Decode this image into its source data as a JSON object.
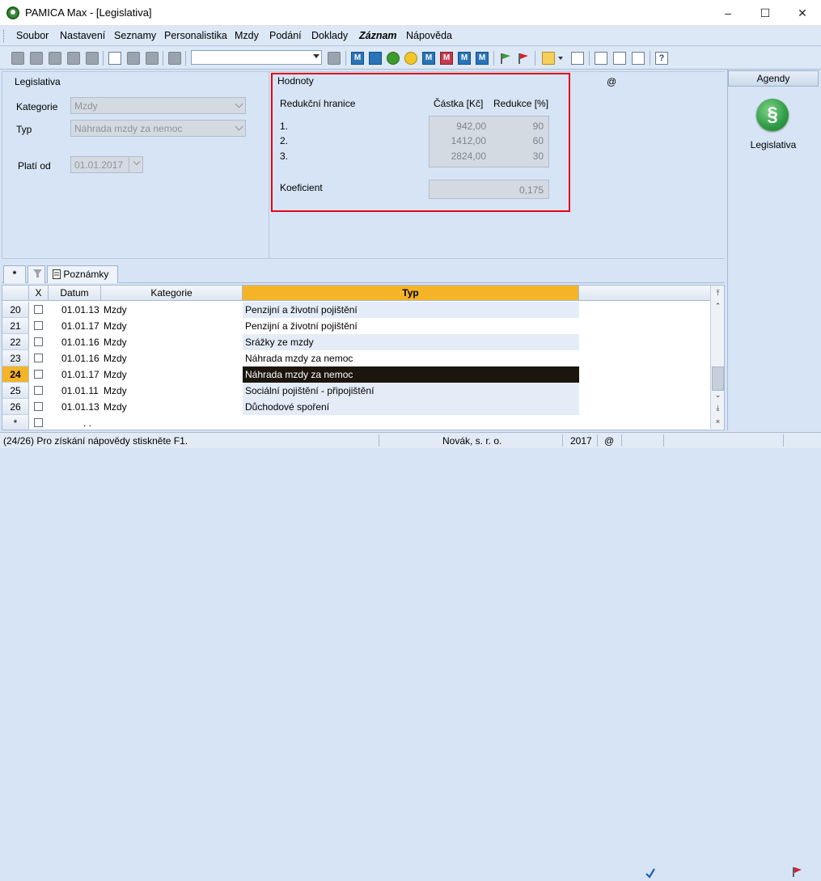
{
  "window": {
    "title": "PAMICA Max - [Legislativa]",
    "minimize": "–",
    "maximize": "☐",
    "close": "✕"
  },
  "menu": [
    "Soubor",
    "Nastavení",
    "Seznamy",
    "Personalistika",
    "Mzdy",
    "Podání",
    "Doklady",
    "Záznam",
    "Nápověda"
  ],
  "toolbar": {
    "combo_value": "",
    "letter_m": "M"
  },
  "form": {
    "section_title": "Legislativa",
    "kategorie_label": "Kategorie",
    "kategorie_value": "Mzdy",
    "typ_label": "Typ",
    "typ_value": "Náhrada mzdy za nemoc",
    "plati_od_label": "Platí od",
    "plati_od_value": "01.01.2017",
    "at_sign": "@"
  },
  "hodnoty": {
    "title": "Hodnoty",
    "col_hranice": "Redukční hranice",
    "col_castka": "Částka [Kč]",
    "col_redukce": "Redukce [%]",
    "rows": [
      {
        "label": "1.",
        "castka": "942,00",
        "redukce": "90"
      },
      {
        "label": "2.",
        "castka": "1412,00",
        "redukce": "60"
      },
      {
        "label": "3.",
        "castka": "2824,00",
        "redukce": "30"
      }
    ],
    "koeficient_label": "Koeficient",
    "koeficient_value": "0,175"
  },
  "agenda": {
    "header": "Agendy",
    "icon_glyph": "§",
    "item_label": "Legislativa"
  },
  "tabs": {
    "star": "*",
    "notes": "Poznámky"
  },
  "grid": {
    "headers": {
      "x": "X",
      "datum": "Datum",
      "kategorie": "Kategorie",
      "typ": "Typ"
    },
    "rows": [
      {
        "n": "20",
        "datum": "01.01.13",
        "kategorie": "Mzdy",
        "typ": "Penzijní a životní pojištění"
      },
      {
        "n": "21",
        "datum": "01.01.17",
        "kategorie": "Mzdy",
        "typ": "Penzijní a životní pojištění"
      },
      {
        "n": "22",
        "datum": "01.01.16",
        "kategorie": "Mzdy",
        "typ": "Srážky ze mzdy"
      },
      {
        "n": "23",
        "datum": "01.01.16",
        "kategorie": "Mzdy",
        "typ": "Náhrada mzdy za nemoc"
      },
      {
        "n": "24",
        "datum": "01.01.17",
        "kategorie": "Mzdy",
        "typ": "Náhrada mzdy za nemoc"
      },
      {
        "n": "25",
        "datum": "01.01.11",
        "kategorie": "Mzdy",
        "typ": "Sociální pojištění - připojištění"
      },
      {
        "n": "26",
        "datum": "01.01.13",
        "kategorie": "Mzdy",
        "typ": "Důchodové spoření"
      }
    ],
    "new_row_marker": "*",
    "new_row_datum": ". .",
    "selected_row": "24"
  },
  "statusbar": {
    "help_text": "(24/26) Pro získání nápovědy stiskněte F1.",
    "company": "Novák, s. r. o.",
    "year": "2017",
    "at": "@"
  },
  "colors": {
    "accent_orange": "#f5b427",
    "highlight_red": "#e30613",
    "selected_row_bg": "#1c150d",
    "panel_bg": "#d6e4f5"
  }
}
